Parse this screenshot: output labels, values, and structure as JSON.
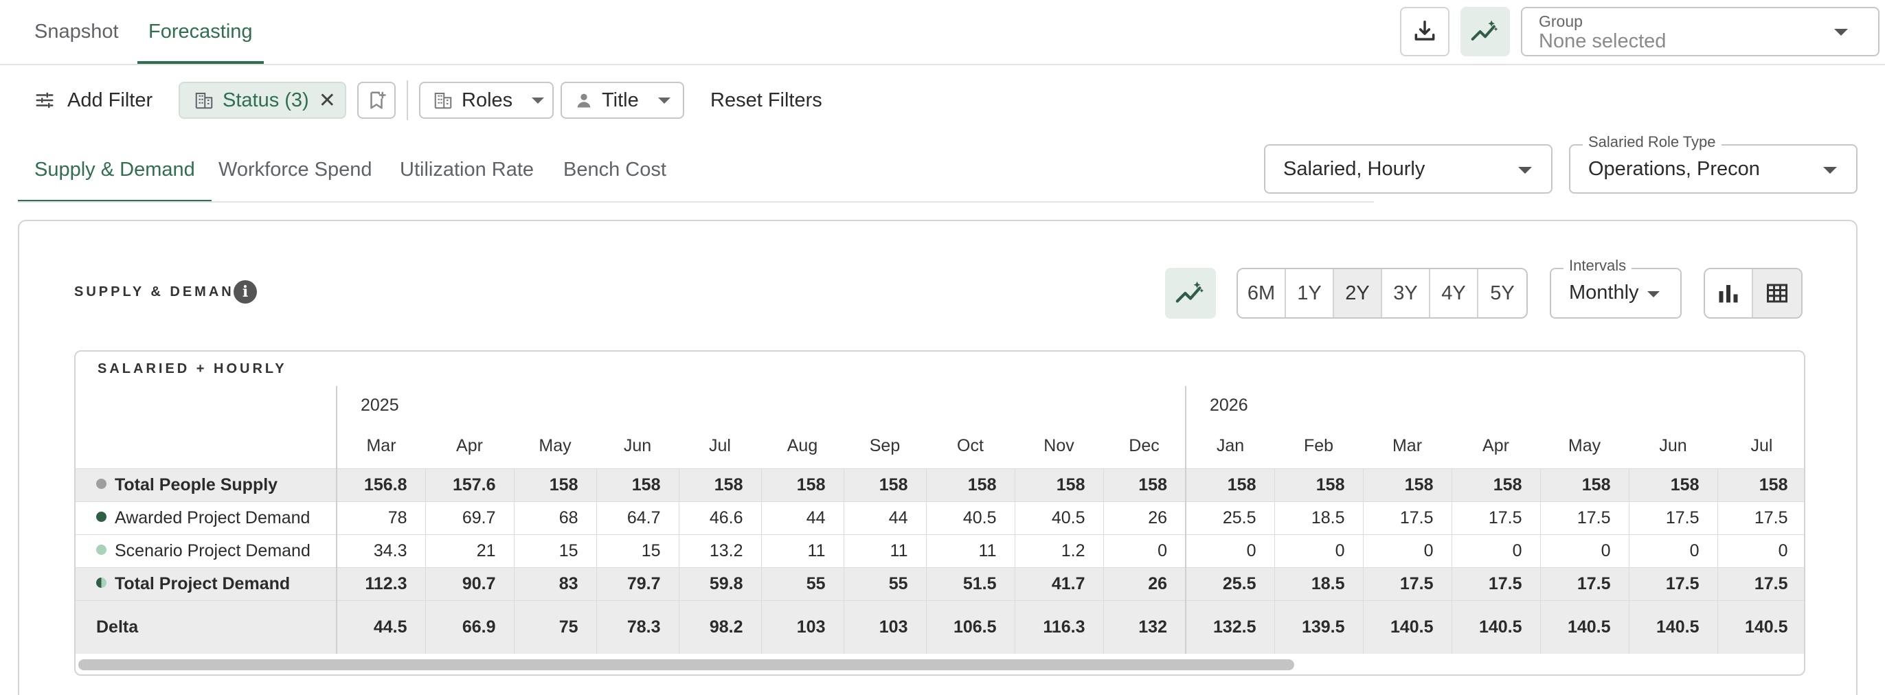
{
  "nav": {
    "tabs": [
      {
        "label": "Snapshot",
        "active": false
      },
      {
        "label": "Forecasting",
        "active": true
      }
    ]
  },
  "group_select": {
    "label": "Group",
    "value": "None selected"
  },
  "filters": {
    "add_filter": "Add Filter",
    "status_chip": "Status (3)",
    "roles": "Roles",
    "title": "Title",
    "reset": "Reset Filters"
  },
  "subtabs": [
    {
      "label": "Supply & Demand",
      "active": true
    },
    {
      "label": "Workforce Spend",
      "active": false
    },
    {
      "label": "Utilization Rate",
      "active": false
    },
    {
      "label": "Bench Cost",
      "active": false
    }
  ],
  "employment_select": {
    "value": "Salaried, Hourly"
  },
  "role_type_select": {
    "label": "Salaried Role Type",
    "value": "Operations, Precon"
  },
  "section": {
    "title": "SUPPLY & DEMAND"
  },
  "ranges": [
    {
      "label": "6M",
      "active": false
    },
    {
      "label": "1Y",
      "active": false
    },
    {
      "label": "2Y",
      "active": true
    },
    {
      "label": "3Y",
      "active": false
    },
    {
      "label": "4Y",
      "active": false
    },
    {
      "label": "5Y",
      "active": false
    }
  ],
  "intervals": {
    "label": "Intervals",
    "value": "Monthly"
  },
  "table": {
    "title": "SALARIED + HOURLY",
    "years": [
      {
        "label": "2025",
        "span": 10
      },
      {
        "label": "2026",
        "span": 7
      }
    ],
    "months": [
      "Mar",
      "Apr",
      "May",
      "Jun",
      "Jul",
      "Aug",
      "Sep",
      "Oct",
      "Nov",
      "Dec",
      "Jan",
      "Feb",
      "Mar",
      "Apr",
      "May",
      "Jun",
      "Jul"
    ],
    "rows": [
      {
        "label": "Total People Supply",
        "bold": true,
        "dot": "#9e9e9e",
        "dot_style": "full",
        "values": [
          "156.8",
          "157.6",
          "158",
          "158",
          "158",
          "158",
          "158",
          "158",
          "158",
          "158",
          "158",
          "158",
          "158",
          "158",
          "158",
          "158",
          "158"
        ]
      },
      {
        "label": "Awarded Project Demand",
        "bold": false,
        "dot": "#2f5d46",
        "dot_style": "full",
        "values": [
          "78",
          "69.7",
          "68",
          "64.7",
          "46.6",
          "44",
          "44",
          "40.5",
          "40.5",
          "26",
          "25.5",
          "18.5",
          "17.5",
          "17.5",
          "17.5",
          "17.5",
          "17.5"
        ]
      },
      {
        "label": "Scenario Project Demand",
        "bold": false,
        "dot": "#a9d3b6",
        "dot_style": "full",
        "values": [
          "34.3",
          "21",
          "15",
          "15",
          "13.2",
          "11",
          "11",
          "11",
          "1.2",
          "0",
          "0",
          "0",
          "0",
          "0",
          "0",
          "0",
          "0"
        ]
      },
      {
        "label": "Total Project Demand",
        "bold": true,
        "dot": "#2f5d46",
        "dot_style": "half",
        "values": [
          "112.3",
          "90.7",
          "83",
          "79.7",
          "59.8",
          "55",
          "55",
          "51.5",
          "41.7",
          "26",
          "25.5",
          "18.5",
          "17.5",
          "17.5",
          "17.5",
          "17.5",
          "17.5"
        ]
      },
      {
        "label": "Delta",
        "bold": true,
        "delta": true,
        "dot": "",
        "dot_style": "none",
        "values": [
          "44.5",
          "66.9",
          "75",
          "78.3",
          "98.2",
          "103",
          "103",
          "106.5",
          "116.3",
          "132",
          "132.5",
          "139.5",
          "140.5",
          "140.5",
          "140.5",
          "140.5",
          "140.5"
        ]
      }
    ]
  },
  "colors": {
    "accent": "#2f6f50",
    "chip_bg": "#e5ede8"
  },
  "icons": [
    "download-icon",
    "forecast-trend-icon",
    "filter-sliders-icon",
    "building-icon",
    "close-icon",
    "bookmark-add-icon",
    "person-icon",
    "info-icon",
    "bar-chart-icon",
    "table-icon"
  ]
}
